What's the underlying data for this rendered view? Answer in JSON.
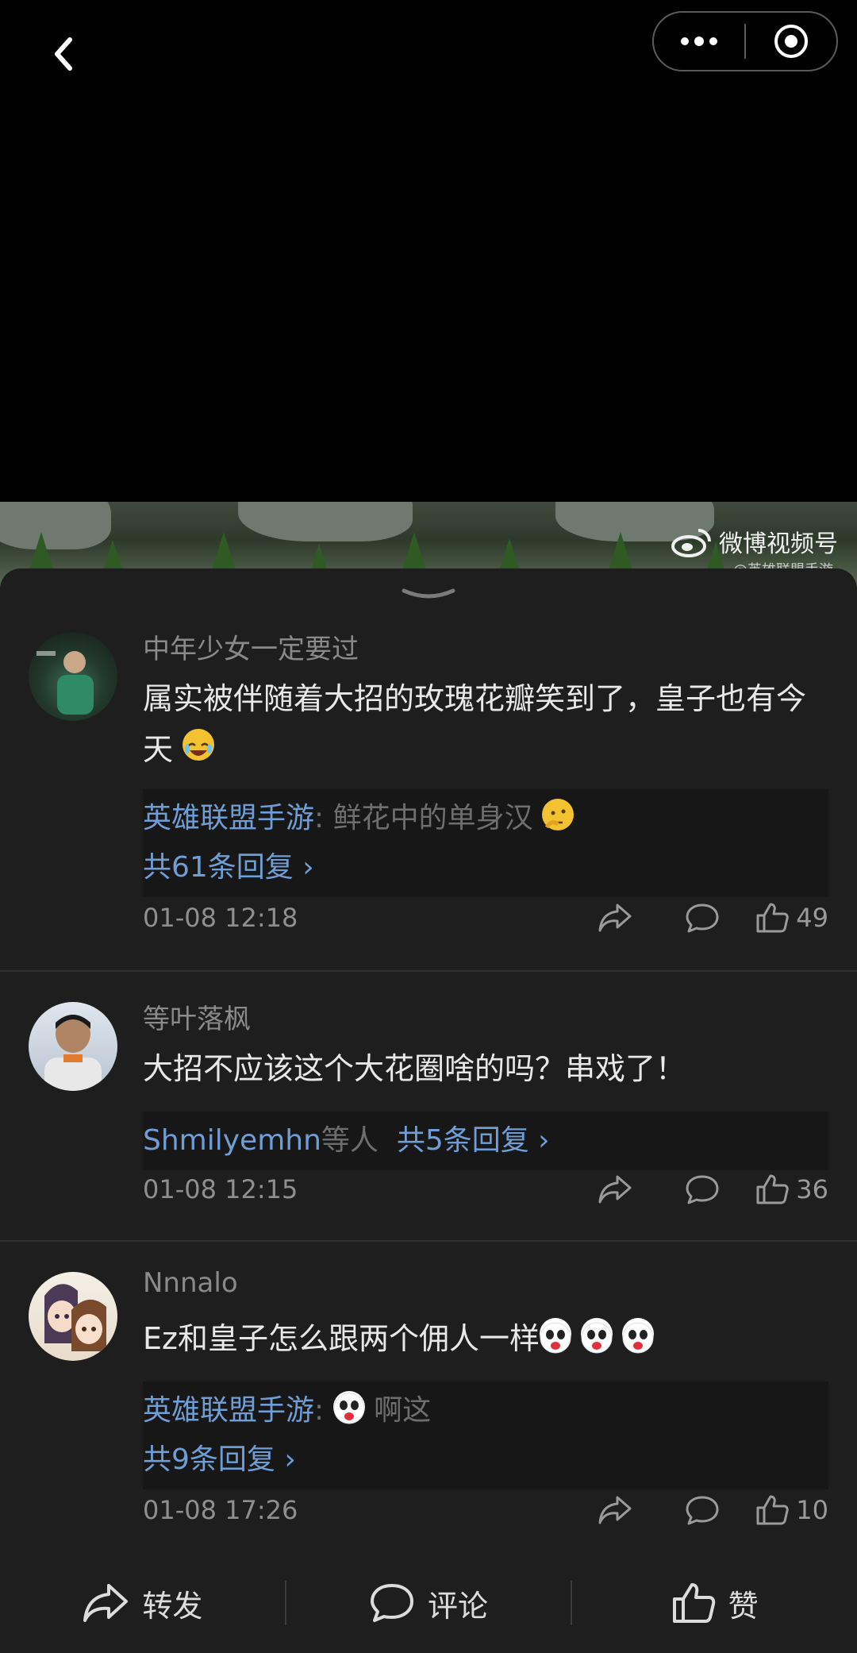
{
  "watermark": {
    "brand": "微博视频号",
    "sub": "@英雄联盟手游"
  },
  "comments": [
    {
      "username": "中年少女一定要过",
      "text": "属实被伴随着大招的玫瑰花瓣笑到了，皇子也有今天",
      "reply_author": "英雄联盟手游",
      "reply_sep": ":",
      "reply_text": "鲜花中的单身汉",
      "reply_count": "共61条回复",
      "time": "01-08 12:18",
      "likes": "49"
    },
    {
      "username": "等叶落枫",
      "text": "大招不应该这个大花圈啥的吗？串戏了！",
      "reply_author": "Shmilyemhn",
      "reply_suffix": "等人",
      "reply_count": "共5条回复",
      "time": "01-08 12:15",
      "likes": "36"
    },
    {
      "username": "Nnnalo",
      "text": "Ez和皇子怎么跟两个佣人一样",
      "reply_author": "英雄联盟手游",
      "reply_sep": ":",
      "reply_text": "啊这",
      "reply_count": "共9条回复",
      "time": "01-08 17:26",
      "likes": "10"
    }
  ],
  "bottom_bar": {
    "forward": "转发",
    "comment": "评论",
    "like": "赞"
  },
  "icons": [
    "back-arrow-icon",
    "more-dots-icon",
    "record-circle-icon",
    "weibo-logo-icon",
    "share-icon",
    "comment-bubble-icon",
    "thumbs-up-icon",
    "chevron-right-icon",
    "laugh-emoji-icon",
    "thinking-emoji-icon",
    "doge-emoji-icon"
  ],
  "colors": {
    "background": "#1e1e1e",
    "link": "#6f9ed6",
    "muted": "#8a8a8a"
  }
}
